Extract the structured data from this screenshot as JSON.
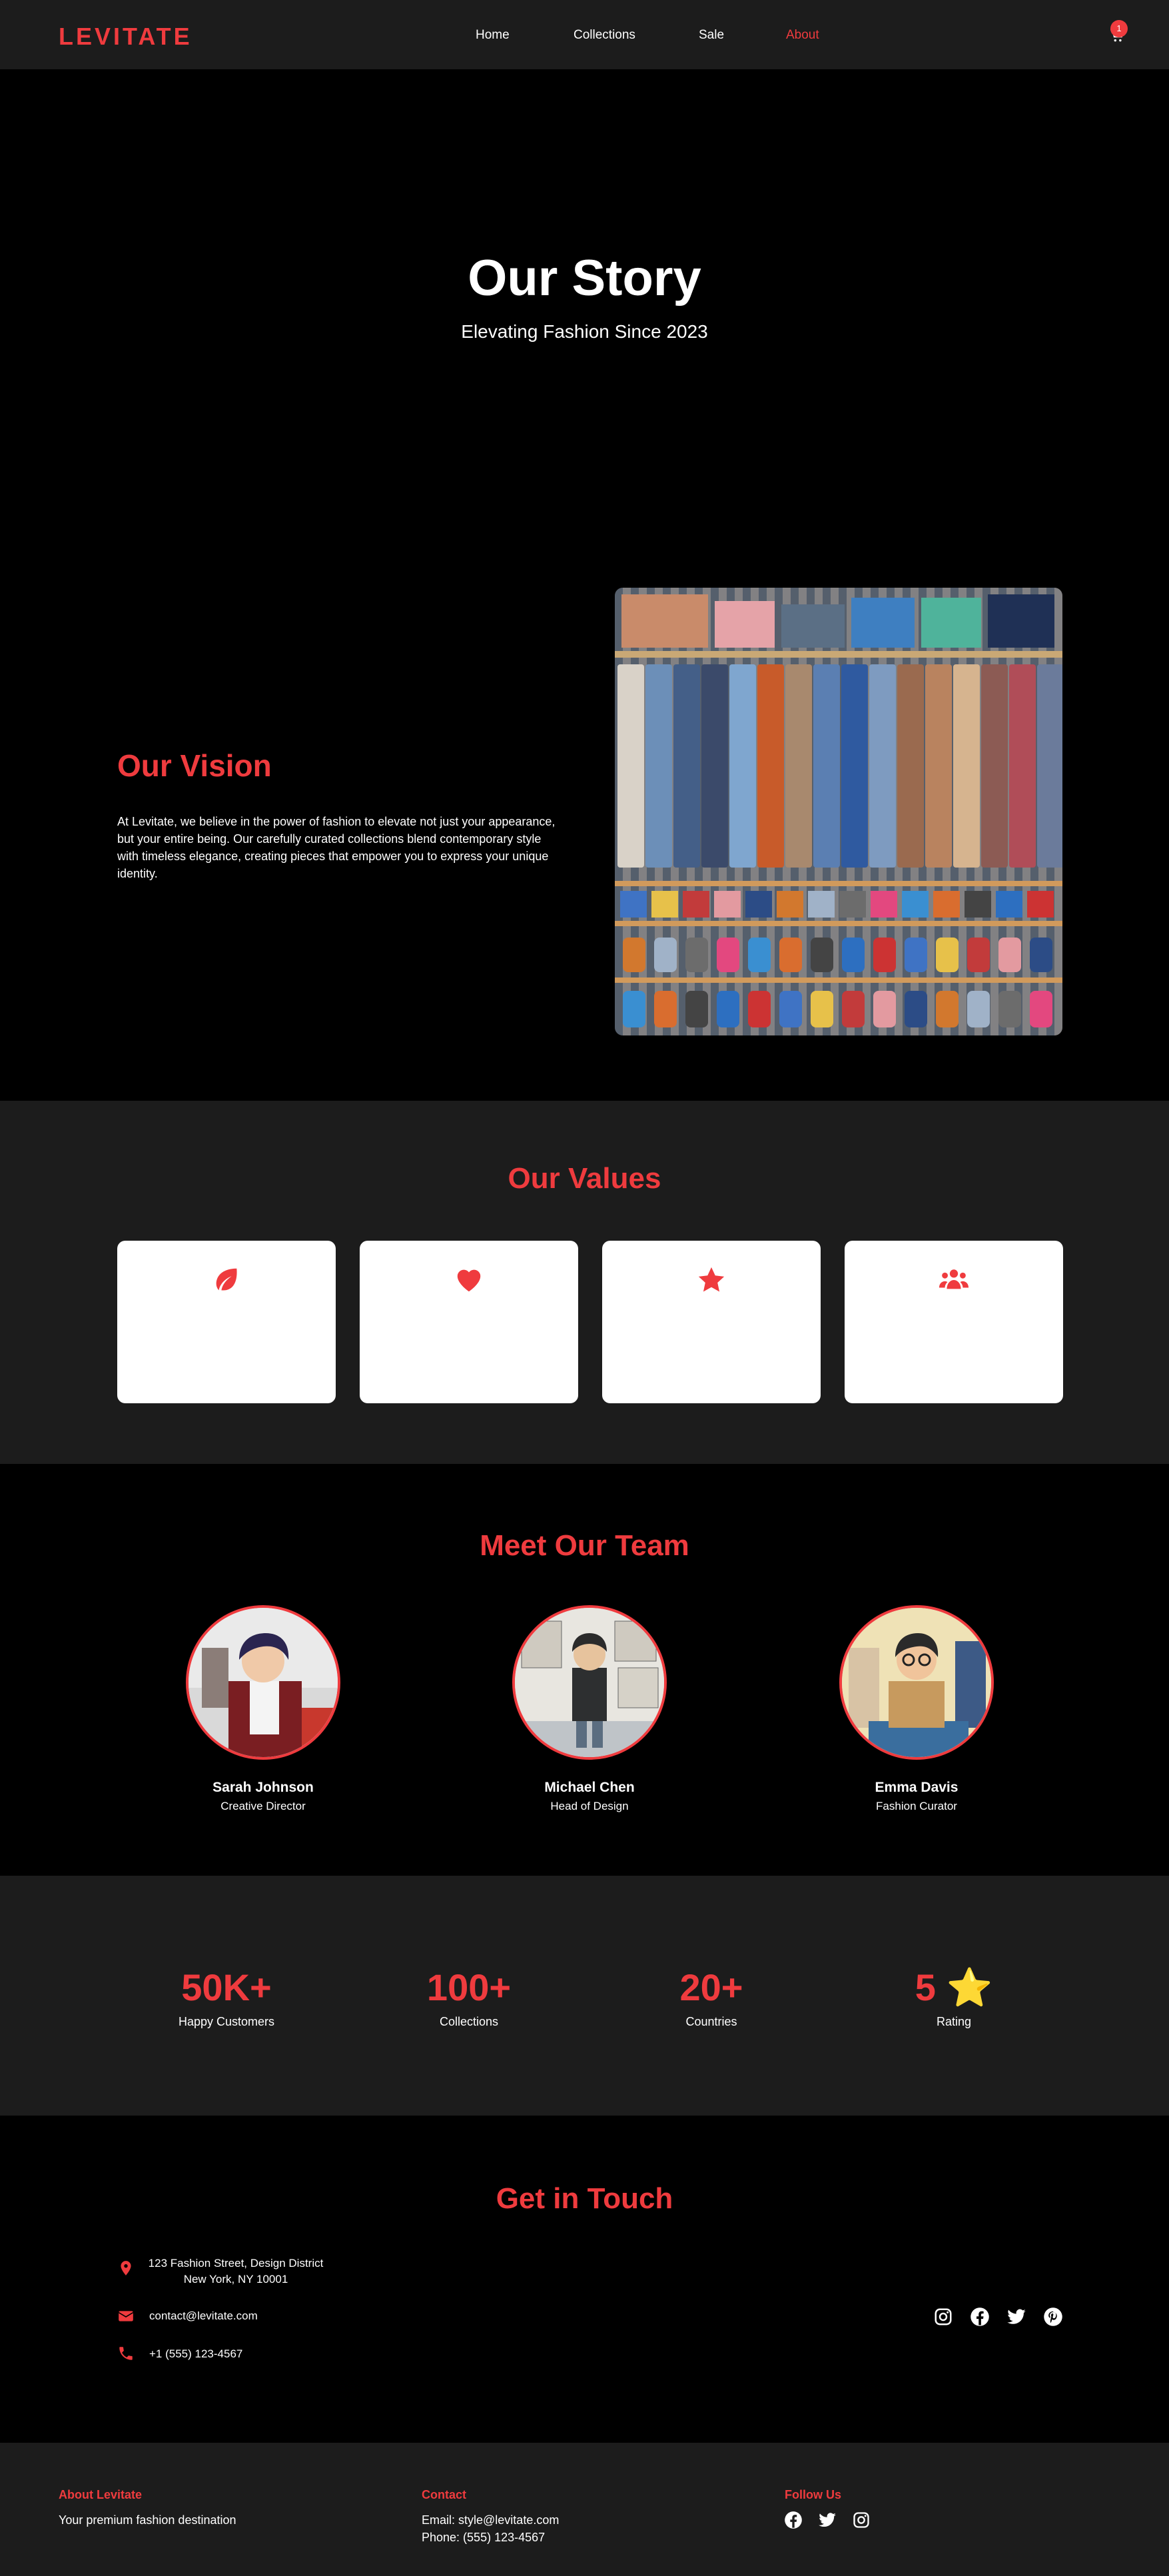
{
  "nav": {
    "logo": "LEVITATE",
    "items": [
      "Home",
      "Collections",
      "Sale",
      "About"
    ],
    "active": "About",
    "cart_count": "1"
  },
  "hero": {
    "title": "Our Story",
    "subtitle": "Elevating Fashion Since 2023"
  },
  "vision": {
    "title": "Our Vision",
    "text": "At Levitate, we believe in the power of fashion to elevate not just your appearance, but your entire being. Our carefully curated collections blend contemporary style with timeless elegance, creating pieces that empower you to express your unique identity.",
    "image": "closet-photo"
  },
  "values": {
    "title": "Our Values",
    "cards": [
      {
        "icon": "leaf-icon"
      },
      {
        "icon": "heart-icon"
      },
      {
        "icon": "star-icon"
      },
      {
        "icon": "users-icon"
      }
    ]
  },
  "team": {
    "title": "Meet Our Team",
    "members": [
      {
        "name": "Sarah Johnson",
        "role": "Creative Director"
      },
      {
        "name": "Michael Chen",
        "role": "Head of Design"
      },
      {
        "name": "Emma Davis",
        "role": "Fashion Curator"
      }
    ]
  },
  "stats": [
    {
      "value": "50K+",
      "label": "Happy Customers"
    },
    {
      "value": "100+",
      "label": "Collections"
    },
    {
      "value": "20+",
      "label": "Countries"
    },
    {
      "value": "5 ⭐",
      "label": "Rating"
    }
  ],
  "contact": {
    "title": "Get in Touch",
    "address_line1": "123 Fashion Street, Design District",
    "address_line2": "New York, NY 10001",
    "email": "contact@levitate.com",
    "phone": "+1 (555) 123-4567",
    "social": [
      "instagram-icon",
      "facebook-icon",
      "twitter-icon",
      "pinterest-icon"
    ]
  },
  "footer": {
    "about_title": "About Levitate",
    "about_text": "Your premium fashion destination",
    "contact_title": "Contact",
    "contact_email": "Email: style@levitate.com",
    "contact_phone": "Phone: (555) 123-4567",
    "follow_title": "Follow Us",
    "social": [
      "facebook-icon",
      "twitter-icon",
      "instagram-icon"
    ]
  },
  "colors": {
    "accent": "#ef3b3e",
    "background": "#000000",
    "panel": "#1c1c1c"
  }
}
